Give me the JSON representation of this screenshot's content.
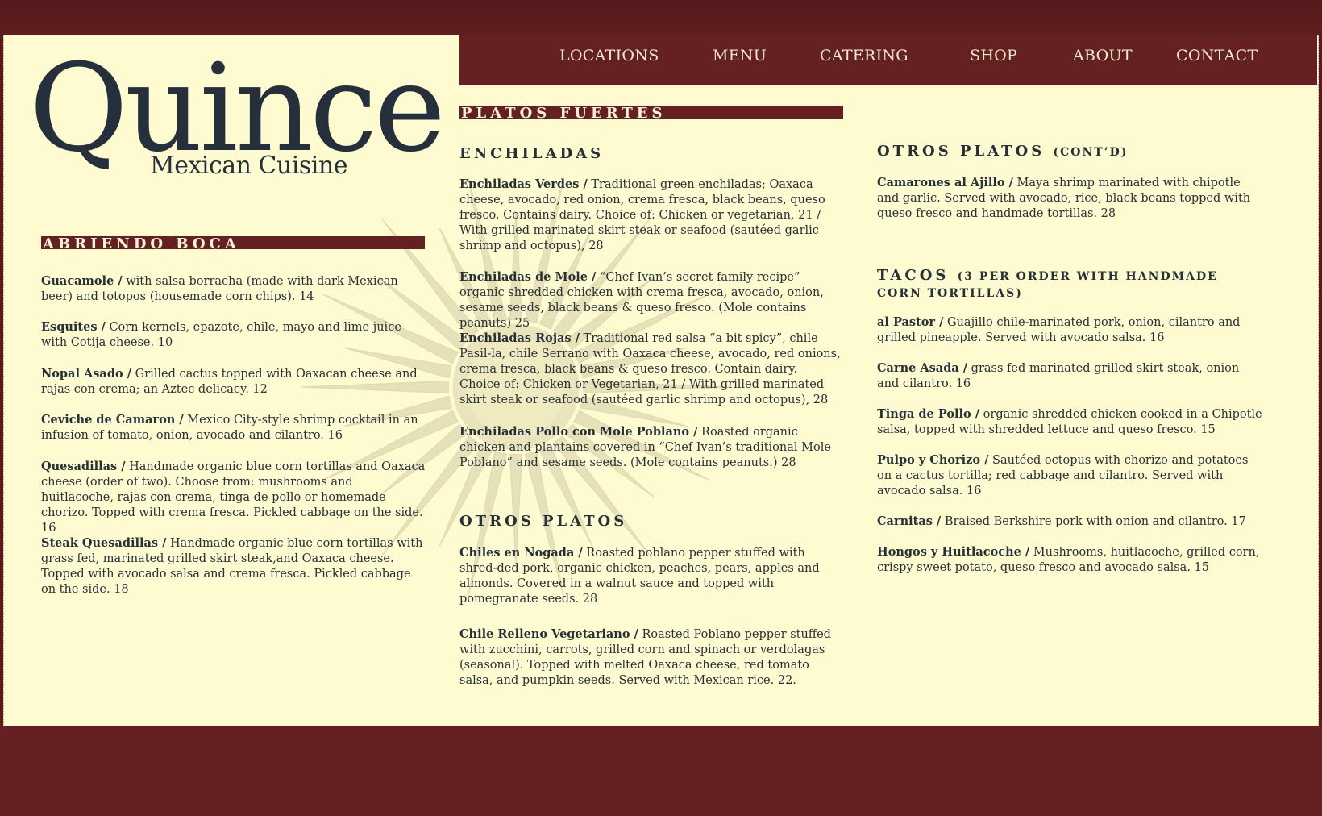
{
  "brand": {
    "name": "Quince",
    "tagline": "Mexican Cuisine"
  },
  "nav": [
    "LOCATIONS",
    "MENU",
    "CATERING",
    "SHOP",
    "ABOUT",
    "CONTACT"
  ],
  "colors": {
    "maroon": "#652022",
    "cream": "#fefbd0",
    "ink": "#26303a"
  },
  "abriendo": {
    "title": "ABRIENDO BOCA",
    "items": [
      {
        "name": "Guacamole /",
        "desc": " with salsa borracha (made with dark Mexican beer) and totopos (housemade corn chips). 14"
      },
      {
        "name": "Esquites /",
        "desc": " Corn kernels, epazote, chile, mayo and lime juice with Cotija cheese. 10"
      },
      {
        "name": "Nopal Asado /",
        "desc": " Grilled cactus topped with Oaxacan cheese and rajas con crema; an Aztec delicacy. 12"
      },
      {
        "name": "Ceviche de Camaron /",
        "desc": " Mexico City-style shrimp cocktail in an infusion of tomato, onion, avocado and cilantro. 16"
      },
      {
        "name": "Quesadillas /",
        "desc": " Handmade organic blue corn tortillas and Oaxaca cheese (order of two). Choose from: mushrooms and huitlacoche, rajas con crema, tinga de pollo or homemade chorizo. Topped with crema fresca. Pickled cabbage on the side. 16"
      },
      {
        "name": "Steak Quesadillas /",
        "desc": " Handmade organic blue corn tortillas with grass fed, marinated grilled skirt steak,and Oaxaca cheese. Topped with avocado salsa and crema fresca. Pickled cabbage on the side. 18"
      }
    ]
  },
  "platos": {
    "title": "PLATOS FUERTES",
    "enchiladas_heading": "ENCHILADAS",
    "enchiladas": [
      {
        "name": "Enchiladas Verdes /",
        "desc": " Traditional green enchiladas; Oaxaca cheese, avocado, red onion, crema fresca, black beans, queso fresco. Contains dairy. Choice of: Chicken or vegetarian, 21 / With grilled marinated skirt steak or seafood (sautéed garlic shrimp and octopus), 28"
      },
      {
        "name": "Enchiladas de Mole /",
        "desc": " “Chef Ivan’s secret family recipe” organic shredded chicken with crema fresca, avocado, onion, sesame seeds, black beans & queso fresco. (Mole contains peanuts) 25"
      },
      {
        "name": "Enchiladas Rojas /",
        "desc": " Traditional red salsa “a bit spicy”, chile Pasil-la, chile Serrano with Oaxaca cheese, avocado, red onions, crema fresca, black beans & queso fresco. Contain dairy. Choice of: Chicken or Vegetarian, 21 / With grilled marinated skirt steak or seafood (sautéed garlic shrimp and octopus), 28"
      },
      {
        "name": "Enchiladas Pollo con Mole Poblano /",
        "desc": " Roasted organic chicken and plantains covered in “Chef Ivan’s traditional Mole Poblano” and sesame seeds. (Mole contains peanuts.) 28"
      }
    ],
    "otros_heading": "OTROS PLATOS",
    "otros": [
      {
        "name": "Chiles en Nogada /",
        "desc": " Roasted poblano pepper stuffed with shred-ded pork, organic chicken, peaches, pears, apples and almonds. Covered in a walnut sauce and topped with pomegranate seeds. 28"
      },
      {
        "name": "Chile Relleno Vegetariano /",
        "desc": " Roasted Poblano pepper stuffed with zucchini, carrots, grilled corn and spinach or verdolagas (seasonal). Topped with melted Oaxaca cheese, red tomato salsa, and pumpkin seeds. Served with Mexican rice. 22."
      }
    ]
  },
  "otros_cont": {
    "heading": "OTROS PLATOS",
    "heading_sub": "(CONT’D)",
    "items": [
      {
        "name": "Camarones al Ajillo /",
        "desc": " Maya shrimp marinated with chipotle and garlic. Served with avocado, rice, black beans topped with queso fresco and handmade tortillas. 28"
      }
    ]
  },
  "tacos": {
    "heading": "TACOS",
    "heading_sub": "(3 PER ORDER WITH HANDMADE CORN TORTILLAS)",
    "items": [
      {
        "name": "al Pastor /",
        "desc": " Guajillo chile-marinated pork, onion, cilantro and grilled pineapple. Served with avocado salsa. 16"
      },
      {
        "name": "Carne Asada /",
        "desc": " grass fed marinated grilled skirt steak, onion and cilantro.  16"
      },
      {
        "name": "Tinga de Pollo /",
        "desc": " organic shredded chicken cooked in a Chipotle salsa, topped with shredded lettuce and queso fresco. 15"
      },
      {
        "name": "Pulpo y Chorizo /",
        "desc": " Sautéed octopus with chorizo and potatoes on a cactus tortilla; red cabbage and cilantro. Served with avocado salsa. 16"
      },
      {
        "name": "Carnitas /",
        "desc": " Braised Berkshire pork with onion and cilantro.  17"
      },
      {
        "name": "Hongos y Huitlacoche /",
        "desc": " Mushrooms, huitlacoche, grilled corn, crispy sweet potato, queso fresco and avocado salsa. 15"
      }
    ]
  }
}
